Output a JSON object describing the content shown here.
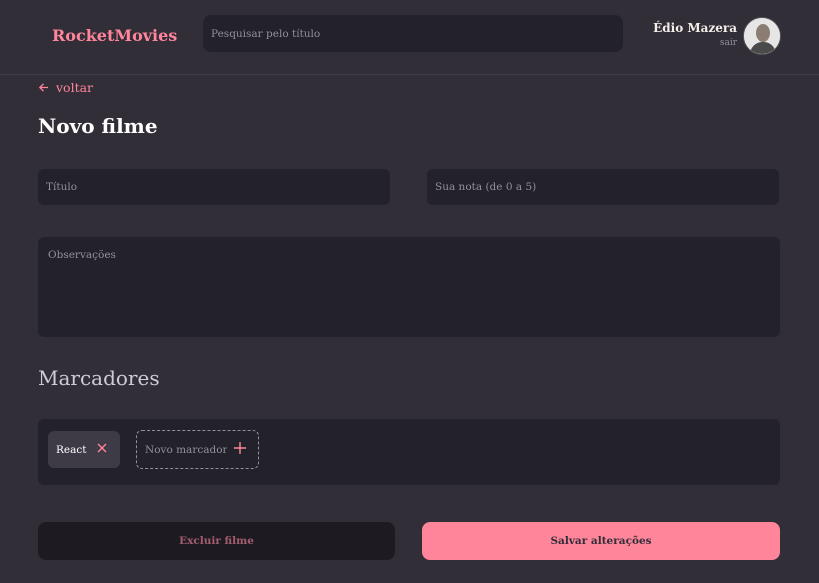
{
  "header": {
    "brand": "RocketMovies",
    "search_placeholder": "Pesquisar pelo título",
    "user_name": "Édio Mazera",
    "signout_label": "sair"
  },
  "nav": {
    "back_label": "voltar"
  },
  "form": {
    "title": "Novo filme",
    "title_placeholder": "Título",
    "rating_placeholder": "Sua nota (de 0 a 5)",
    "notes_placeholder": "Observações",
    "tags_section_title": "Marcadores",
    "tags": [
      {
        "label": "React"
      }
    ],
    "new_tag_placeholder": "Novo marcador",
    "delete_label": "Excluir filme",
    "save_label": "Salvar alterações"
  },
  "colors": {
    "background": "#312e38",
    "accent": "#ff859b",
    "input_bg": "#232129",
    "tag_bg": "#3e3b47"
  },
  "icons": [
    "arrow-left-icon",
    "close-icon",
    "plus-icon"
  ]
}
